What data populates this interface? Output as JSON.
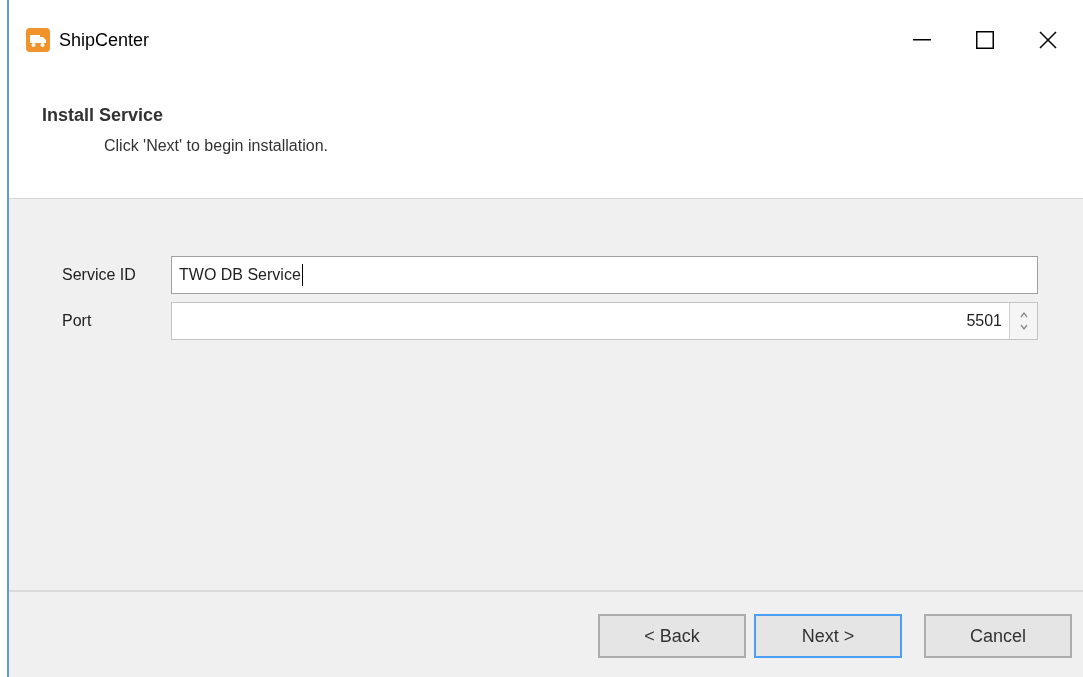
{
  "window": {
    "title": "ShipCenter"
  },
  "header": {
    "title": "Install Service",
    "subtitle": "Click 'Next' to begin installation."
  },
  "fields": [
    {
      "label": "Service ID",
      "kind": "text",
      "value": "TWO DB Service",
      "focused": true
    },
    {
      "label": "Port",
      "kind": "spin",
      "value": "5501",
      "focused": false
    }
  ],
  "buttons": [
    {
      "label": "< Back",
      "focused": false
    },
    {
      "label": "Next >",
      "focused": true
    },
    {
      "label": "Cancel",
      "focused": false
    }
  ]
}
